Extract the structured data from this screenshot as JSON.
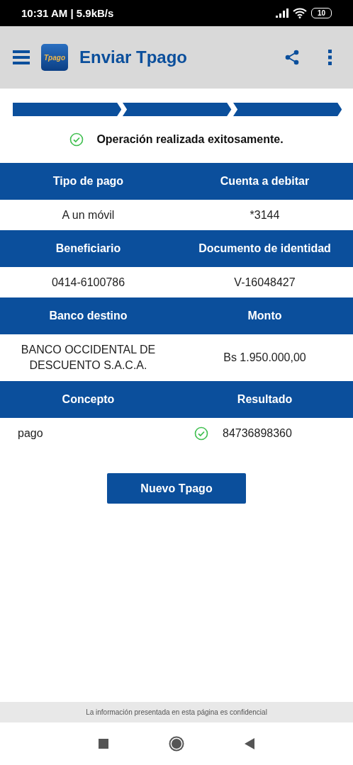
{
  "status_bar": {
    "time": "10:31 AM | 5.9kB/s",
    "battery": "10"
  },
  "app_bar": {
    "logo": "Tpago",
    "title": "Enviar Tpago"
  },
  "steps": [
    {
      "completed": true
    },
    {
      "completed": true
    },
    {
      "completed": true
    }
  ],
  "message": "Operación realizada exitosamente.",
  "details": [
    {
      "headers": [
        "Tipo de pago",
        "Cuenta a debitar"
      ],
      "values": [
        "A un móvil",
        "*3144"
      ]
    },
    {
      "headers": [
        "Beneficiario",
        "Documento de identidad"
      ],
      "values": [
        "0414-6100786",
        "V-16048427"
      ]
    },
    {
      "headers": [
        "Banco destino",
        "Monto"
      ],
      "values": [
        "BANCO OCCIDENTAL DE DESCUENTO S.A.C.A.",
        "Bs 1.950.000,00"
      ]
    },
    {
      "headers": [
        "Concepto",
        "Resultado"
      ],
      "values": [
        "pago",
        "84736898360"
      ],
      "kind": "result"
    }
  ],
  "button": "Nuevo Tpago",
  "footer": "La información presentada en esta página es confidencial"
}
